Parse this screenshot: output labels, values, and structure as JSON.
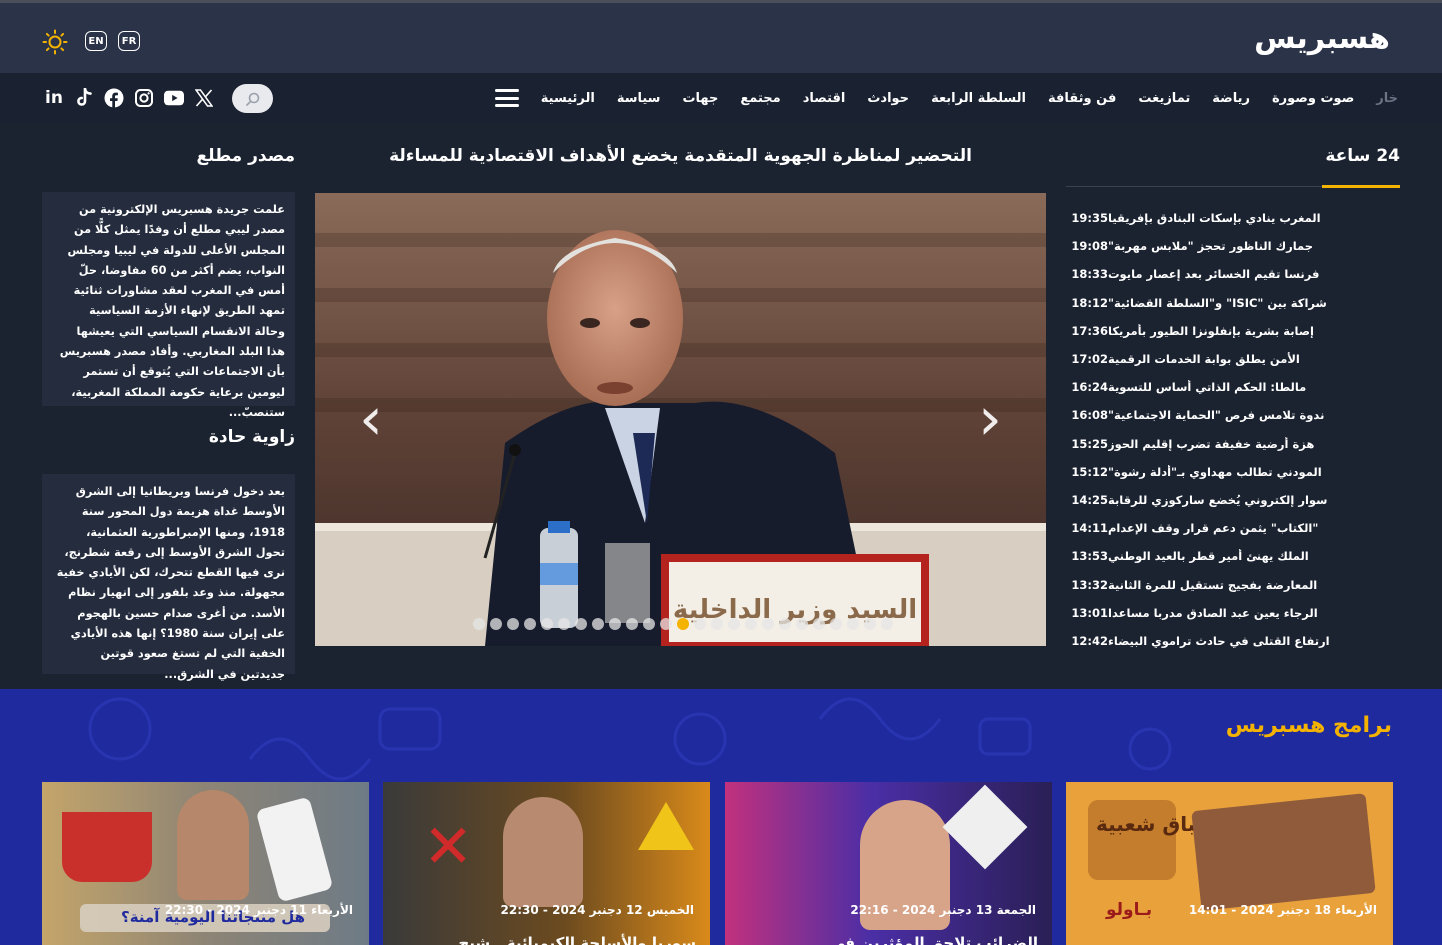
{
  "header": {
    "logo_text": "هسبريس",
    "lang_en": "EN",
    "lang_fr": "FR",
    "theme_icon": "sun-icon"
  },
  "nav": {
    "items": [
      "الرئيسية",
      "سياسة",
      "جهات",
      "مجتمع",
      "اقتصاد",
      "حوادث",
      "السلطة الرابعة",
      "فن وثقافة",
      "تمازيغت",
      "رياضة",
      "صوت وصورة",
      "خار"
    ],
    "socials": [
      "linkedin-icon",
      "tiktok-icon",
      "facebook-icon",
      "instagram-icon",
      "youtube-icon",
      "x-icon"
    ]
  },
  "latest": {
    "title": "24 ساعة",
    "items": [
      {
        "time": "19:35",
        "headline": "المغرب ينادي بإسكات البنادق بإفريقيا"
      },
      {
        "time": "19:08",
        "headline": "جمارك الناظور تحجز \"ملابس مهربة\""
      },
      {
        "time": "18:33",
        "headline": "فرنسا تقيم الخسائر بعد إعصار مايوت"
      },
      {
        "time": "18:12",
        "headline": "شراكة بين \"ISIC\" و\"السلطة القضائية\""
      },
      {
        "time": "17:36",
        "headline": "إصابة بشرية بإنفلونزا الطيور بأمريكا"
      },
      {
        "time": "17:02",
        "headline": "الأمن يطلق بوابة الخدمات الرقمية"
      },
      {
        "time": "16:24",
        "headline": "مالطا: الحكم الذاتي أساس للتسوية"
      },
      {
        "time": "16:08",
        "headline": "ندوة تلامس فرص \"الحماية الاجتماعية\""
      },
      {
        "time": "15:25",
        "headline": "هزة أرضية خفيفة تضرب إقليم الحوز"
      },
      {
        "time": "15:12",
        "headline": "المودني تطالب مهداوي بـ\"أدلة رشوة\""
      },
      {
        "time": "14:25",
        "headline": "سوار إلكتروني يُخضع ساركوزي للرقابة"
      },
      {
        "time": "14:11",
        "headline": "\"الكتاب\" يثمن دعم قرار وقف الإعدام"
      },
      {
        "time": "13:53",
        "headline": "الملك يهنئ أمير قطر بالعيد الوطني"
      },
      {
        "time": "13:32",
        "headline": "المعارضة بفجيج تستقيل للمرة الثانية"
      },
      {
        "time": "13:01",
        "headline": "الرجاء يعين عبد الصادق مدربا مساعدا"
      },
      {
        "time": "12:42",
        "headline": "ارتفاع القتلى في حادث تراموي البيضاء"
      }
    ]
  },
  "hero": {
    "title": "التحضير لمناظرة الجهوية المتقدمة يخضع الأهداف الاقتصادية للمساءلة",
    "placard_text": "السيد وزير الداخلية",
    "slide_count": 25,
    "active_slide": 12
  },
  "sidebar": {
    "source_title": "مصدر مطلع",
    "source_text": "علمت جريدة هسبريس الإلكترونية من مصدر ليبي مطلع أن وفدًا يمثل كلًّا من المجلس الأعلى للدولة في ليبيا ومجلس النواب، يضم أكثر من 60 مفاوضا، حلّ أمس في المغرب لعقد مشاورات ثنائية تمهد الطريق لإنهاء الأزمة السياسية وحالة الانقسام السياسي التي يعيشها هذا البلد المغاربي. وأفاد مصدر هسبريس بأن الاجتماعات التي يُتوقع أن تستمر ليومين برعاية حكومة المملكة المغربية، ستنصبّ...",
    "angle_title": "زاوية حادة",
    "angle_text": "بعد دخول فرنسا وبريطانيا إلى الشرق الأوسط غداة هزيمة دول المحور سنة 1918، ومنها الإمبراطورية العثمانية، تحول الشرق الأوسط إلى رقعة شطرنج، نرى فيها القطع تتحرك، لكن الأيادي خفية مجهولة. منذ وعد بلفور إلى انهيار نظام الأسد. من أغرى صدام حسين بالهجوم على إيران سنة 1980؟ إنها هذه الأيادي الخفية التي لم تستغ صعود قوتين جديدتين في الشرق..."
  },
  "programs": {
    "title": "برامج هسبريس",
    "cards": [
      {
        "date": "الأربعاء 18 دجنبر 2024 - 14:01",
        "title": "أطباق شعبية",
        "sub": "بـاولو"
      },
      {
        "date": "الجمعة 13 دجنبر 2024 - 22:16",
        "title": "الضرائب تلاحق المؤثرين في"
      },
      {
        "date": "الخميس 12 دجنبر 2024 - 22:30",
        "title": "سوريا والأسلحة الكيميائية.. شبح"
      },
      {
        "date": "الأربعاء 11 دجنبر 2024 - 22:30",
        "title": "هل منتجاتنا اليومية آمنة؟"
      }
    ]
  },
  "colors": {
    "accent": "#f5b301",
    "header_bg": "#2a3347",
    "page_bg": "#1b2230",
    "programs_bg": "#1f2a9e"
  }
}
